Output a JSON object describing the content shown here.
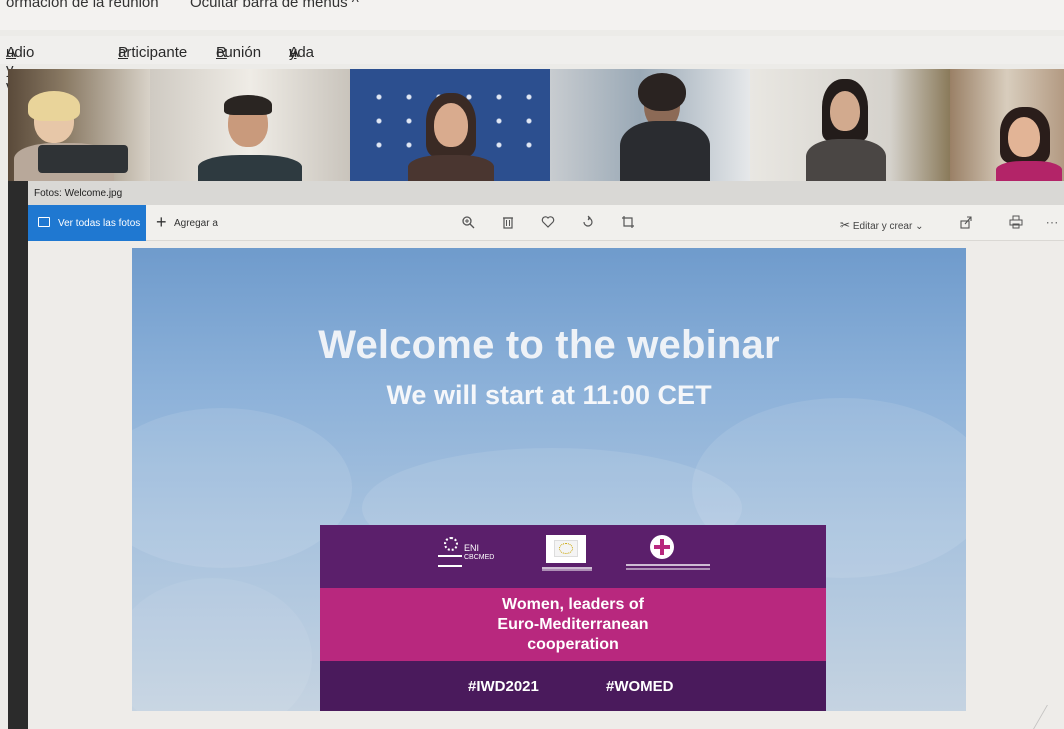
{
  "meeting": {
    "top_left": "ormación de la reunión",
    "top_right": "Ocultar barra de menús ^"
  },
  "menu": {
    "items": [
      {
        "label": "Audio y vídeo",
        "ul": "A",
        "rest": "udio y vídeo"
      },
      {
        "label": "Participante",
        "ul": "P",
        "rest": "articipante"
      },
      {
        "label": "Reunión",
        "ul": "R",
        "rest": "eunión"
      },
      {
        "label": "Ayuda",
        "ul": "y",
        "pre": "A",
        "rest": "uda"
      }
    ]
  },
  "photos": {
    "window_title": "Fotos: Welcome.jpg",
    "see_all": "Ver todas las fotos",
    "add_to": "Agregar a",
    "edit_create": "Editar y crear"
  },
  "slide": {
    "title": "Welcome to the webinar",
    "subtitle": "We will start at 11:00 CET",
    "logos": {
      "eni": "ENI",
      "cbcmed": "CBCMED"
    },
    "banner_lines": [
      "Women, leaders of",
      "Euro-Mediterranean",
      "cooperation"
    ],
    "tag1": "#IWD2021",
    "tag2": "#WOMED"
  },
  "colors": {
    "accent": "#1f78d1",
    "banner_top": "#5b1f6b",
    "banner_mid": "#b8287e",
    "banner_bottom": "#4a1a5c"
  }
}
